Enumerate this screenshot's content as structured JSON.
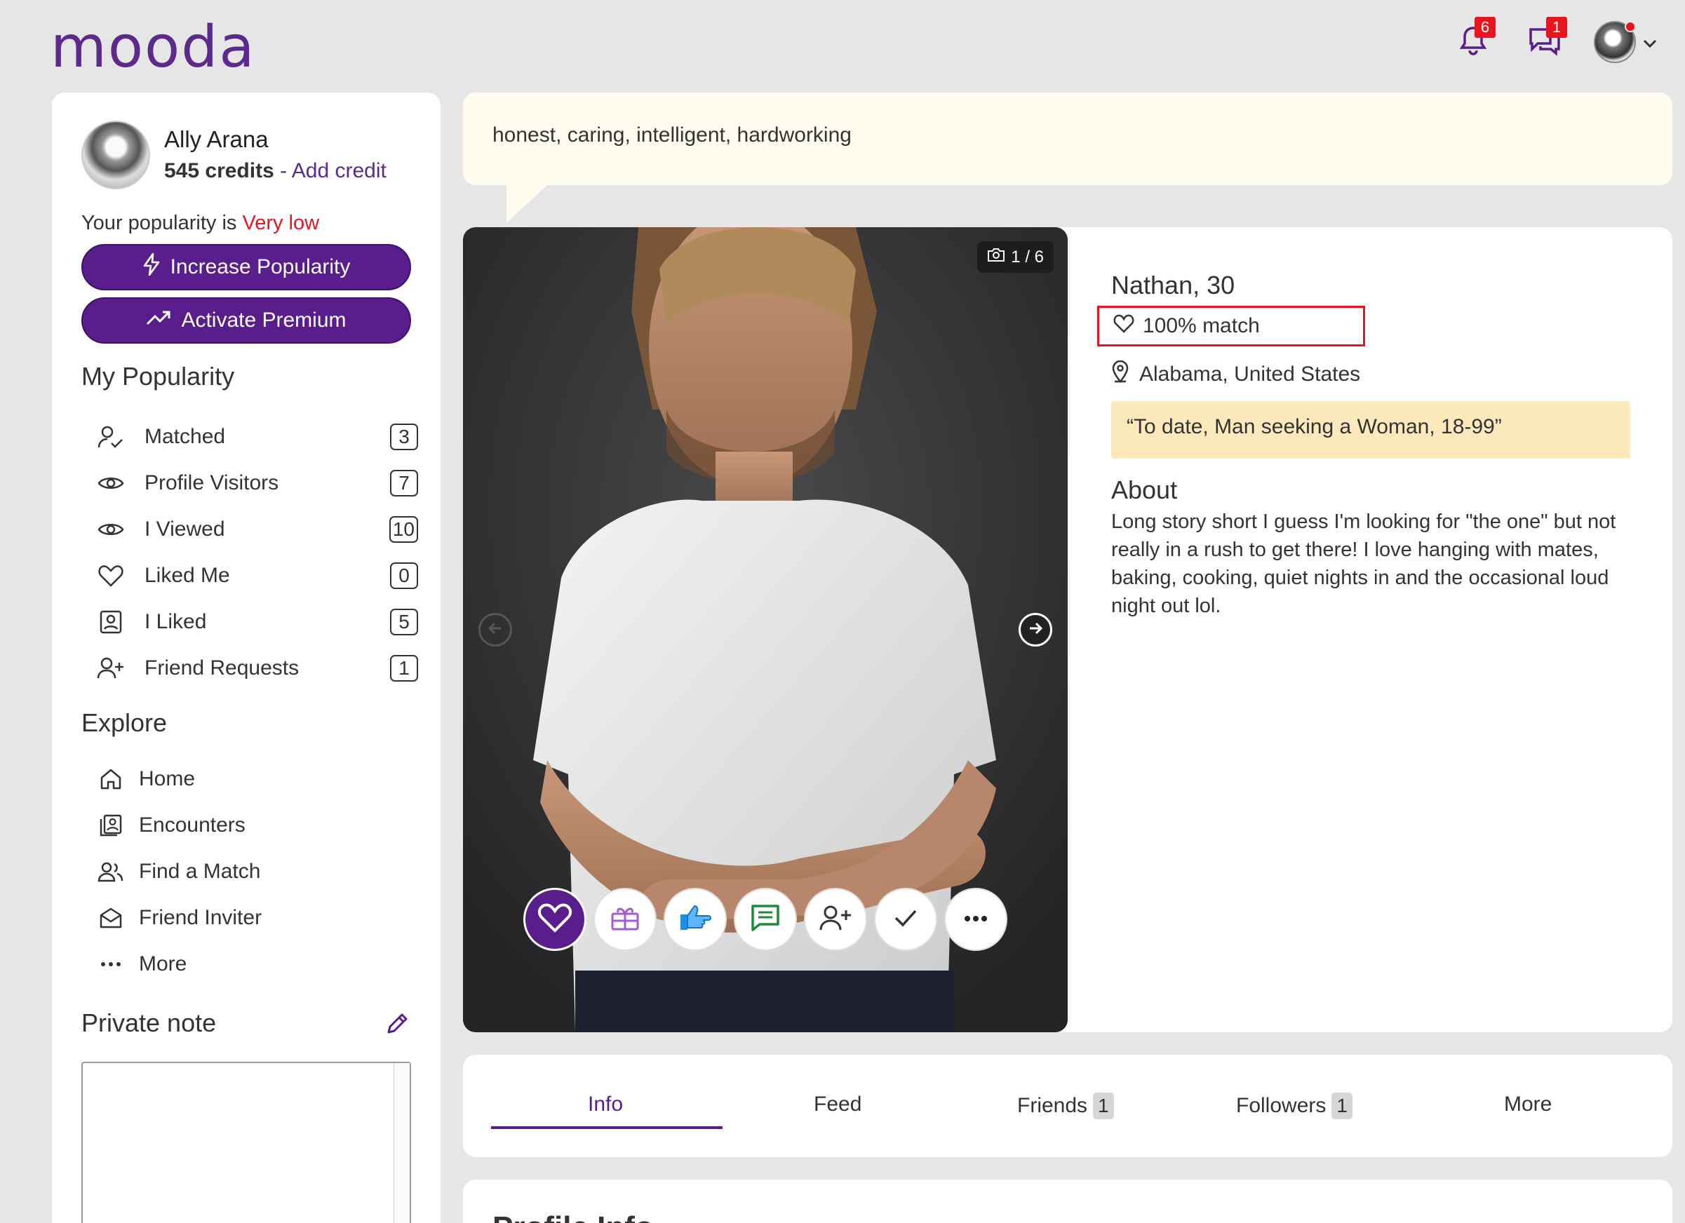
{
  "app": {
    "logo": "mooda"
  },
  "topbar": {
    "notifications_count": "6",
    "messages_count": "1"
  },
  "user": {
    "name": "Ally Arana",
    "credits": "545 credits",
    "separator": " - ",
    "add_credit": "Add credit",
    "popularity_prefix": "Your popularity is ",
    "popularity_level": "Very low"
  },
  "buttons": {
    "increase_popularity": "Increase Popularity",
    "activate_premium": "Activate Premium"
  },
  "my_popularity": {
    "title": "My Popularity",
    "items": [
      {
        "label": "Matched",
        "count": "3",
        "icon": "user-check-icon"
      },
      {
        "label": "Profile Visitors",
        "count": "7",
        "icon": "eye-icon"
      },
      {
        "label": "I Viewed",
        "count": "10",
        "icon": "eye-icon"
      },
      {
        "label": "Liked Me",
        "count": "0",
        "icon": "heart-icon"
      },
      {
        "label": "I Liked",
        "count": "5",
        "icon": "portrait-icon"
      },
      {
        "label": "Friend Requests",
        "count": "1",
        "icon": "user-plus-icon"
      }
    ]
  },
  "explore": {
    "title": "Explore",
    "items": [
      {
        "label": "Home",
        "icon": "home-icon"
      },
      {
        "label": "Encounters",
        "icon": "cards-icon"
      },
      {
        "label": "Find a Match",
        "icon": "users-icon"
      },
      {
        "label": "Friend Inviter",
        "icon": "envelope-icon"
      },
      {
        "label": "More",
        "icon": "more-dots-icon"
      }
    ]
  },
  "private_note": {
    "title": "Private note",
    "value": ""
  },
  "bubble": {
    "text": "honest, caring, intelligent, hardworking"
  },
  "profile": {
    "photo_counter": "1 / 6",
    "name_age": "Nathan, 30",
    "match": "100% match",
    "location": "Alabama, United States",
    "seeking": "“To date, Man seeking a Woman, 18-99”",
    "about_title": "About",
    "about_text": "Long story short I guess I'm looking for \"the one\" but not really in a rush to get there! I love hanging with mates, baking, cooking, quiet nights in and the occasional loud night out lol.",
    "actions": [
      "heart-icon",
      "gift-icon",
      "thumbs-up-icon",
      "chat-icon",
      "add-friend-icon",
      "check-icon",
      "more-icon"
    ]
  },
  "tabs": [
    {
      "label": "Info",
      "badge": ""
    },
    {
      "label": "Feed",
      "badge": ""
    },
    {
      "label": "Friends",
      "badge": "1"
    },
    {
      "label": "Followers",
      "badge": "1"
    },
    {
      "label": "More",
      "badge": ""
    }
  ],
  "next_section": {
    "title": "Profile Info"
  },
  "colors": {
    "brand": "#5a1e8c",
    "alert": "#e8141e",
    "seek_bg": "#fde9bc",
    "bubble_bg": "#fefcef"
  }
}
